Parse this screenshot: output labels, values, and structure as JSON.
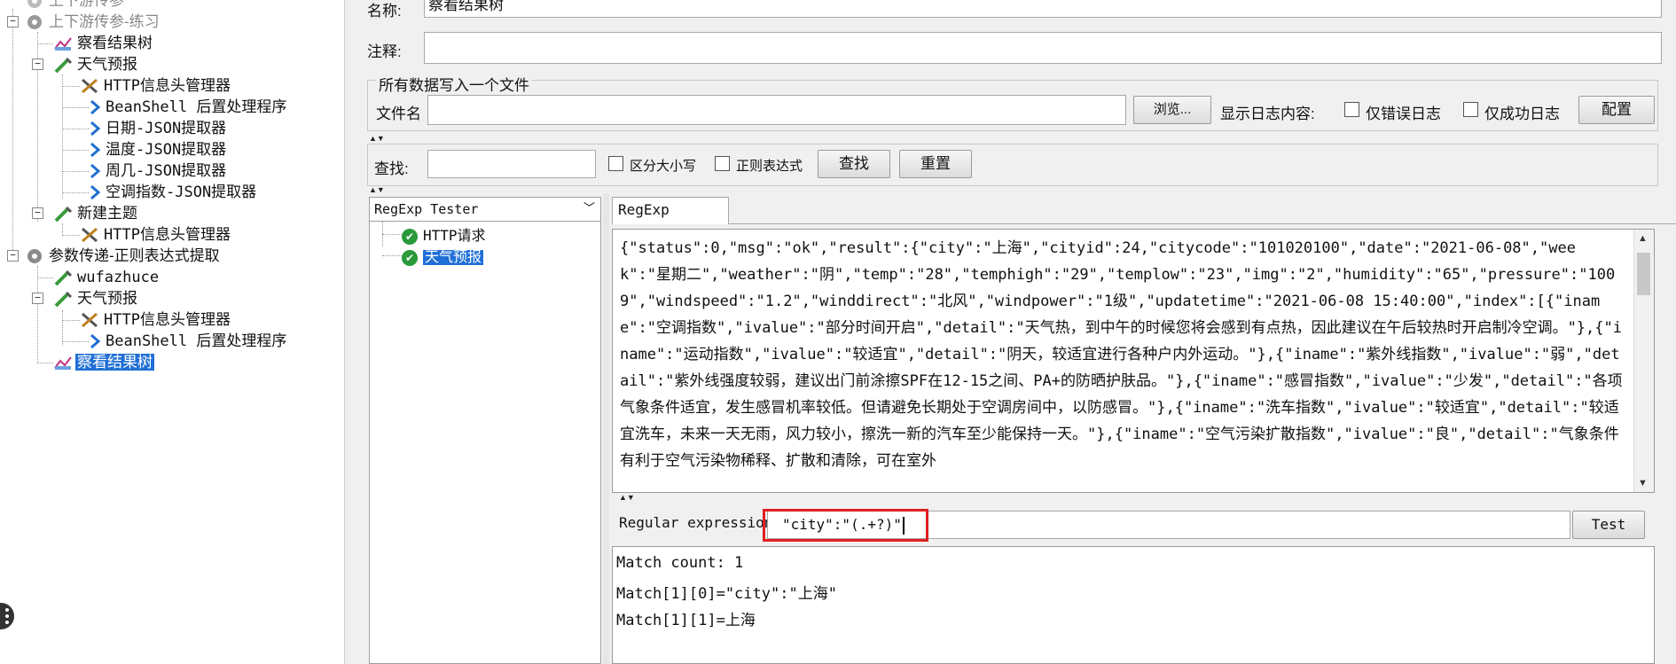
{
  "tree": {
    "nodes": [
      {
        "label": "上下游传参",
        "faded": true
      },
      {
        "label": "上下游传参-练习",
        "faded": true
      },
      {
        "label": "察看结果树"
      },
      {
        "label": "天气预报"
      },
      {
        "label": "HTTP信息头管理器"
      },
      {
        "label": "BeanShell 后置处理程序"
      },
      {
        "label": "日期-JSON提取器"
      },
      {
        "label": "温度-JSON提取器"
      },
      {
        "label": "周几-JSON提取器"
      },
      {
        "label": "空调指数-JSON提取器"
      },
      {
        "label": "新建主题"
      },
      {
        "label": "HTTP信息头管理器"
      },
      {
        "label": "参数传递-正则表达式提取"
      },
      {
        "label": "wufazhuce"
      },
      {
        "label": "天气预报"
      },
      {
        "label": "HTTP信息头管理器"
      },
      {
        "label": "BeanShell 后置处理程序"
      },
      {
        "label": "察看结果树",
        "selected": true
      }
    ]
  },
  "form": {
    "name_label": "名称:",
    "name_value": "察看结果树",
    "comment_label": "注释:",
    "comment_value": "",
    "file_group_title": "所有数据写入一个文件",
    "filename_label": "文件名",
    "filename_value": "",
    "browse_button": "浏览...",
    "log_display_label": "显示日志内容:",
    "errors_only_label": "仅错误日志",
    "success_only_label": "仅成功日志",
    "config_button": "配置"
  },
  "search": {
    "label": "查找:",
    "value": "",
    "case_sensitive_label": "区分大小写",
    "regex_label": "正则表达式",
    "find_button": "查找",
    "reset_button": "重置"
  },
  "results": {
    "renderer_select": "RegExp Tester",
    "samples": [
      {
        "label": "HTTP请求"
      },
      {
        "label": "天气预报",
        "selected": true
      }
    ],
    "tab_label": "RegExp Tester",
    "response_text": "{\"status\":0,\"msg\":\"ok\",\"result\":{\"city\":\"上海\",\"cityid\":24,\"citycode\":\"101020100\",\"date\":\"2021-06-08\",\"week\":\"星期二\",\"weather\":\"阴\",\"temp\":\"28\",\"temphigh\":\"29\",\"templow\":\"23\",\"img\":\"2\",\"humidity\":\"65\",\"pressure\":\"1009\",\"windspeed\":\"1.2\",\"winddirect\":\"北风\",\"windpower\":\"1级\",\"updatetime\":\"2021-06-08 15:40:00\",\"index\":[{\"iname\":\"空调指数\",\"ivalue\":\"部分时间开启\",\"detail\":\"天气热，到中午的时候您将会感到有点热，因此建议在午后较热时开启制冷空调。\"},{\"iname\":\"运动指数\",\"ivalue\":\"较适宜\",\"detail\":\"阴天，较适宜进行各种户内外运动。\"},{\"iname\":\"紫外线指数\",\"ivalue\":\"弱\",\"detail\":\"紫外线强度较弱，建议出门前涂擦SPF在12-15之间、PA+的防晒护肤品。\"},{\"iname\":\"感冒指数\",\"ivalue\":\"少发\",\"detail\":\"各项气象条件适宜，发生感冒机率较低。但请避免长期处于空调房间中，以防感冒。\"},{\"iname\":\"洗车指数\",\"ivalue\":\"较适宜\",\"detail\":\"较适宜洗车，未来一天无雨，风力较小，擦洗一新的汽车至少能保持一天。\"},{\"iname\":\"空气污染扩散指数\",\"ivalue\":\"良\",\"detail\":\"气象条件有利于空气污染物稀释、扩散和清除，可在室外",
    "regex_label": "Regular expression:",
    "regex_value": "\"city\":\"(.+?)\"",
    "test_button": "Test",
    "match_lines": [
      "Match count: 1",
      "Match[1][0]=\"city\":\"上海\"",
      "Match[1][1]=上海"
    ]
  },
  "colors": {
    "selection": "#1f6fd6",
    "highlight_box": "#e02020",
    "success_icon": "#2a9a3a"
  }
}
